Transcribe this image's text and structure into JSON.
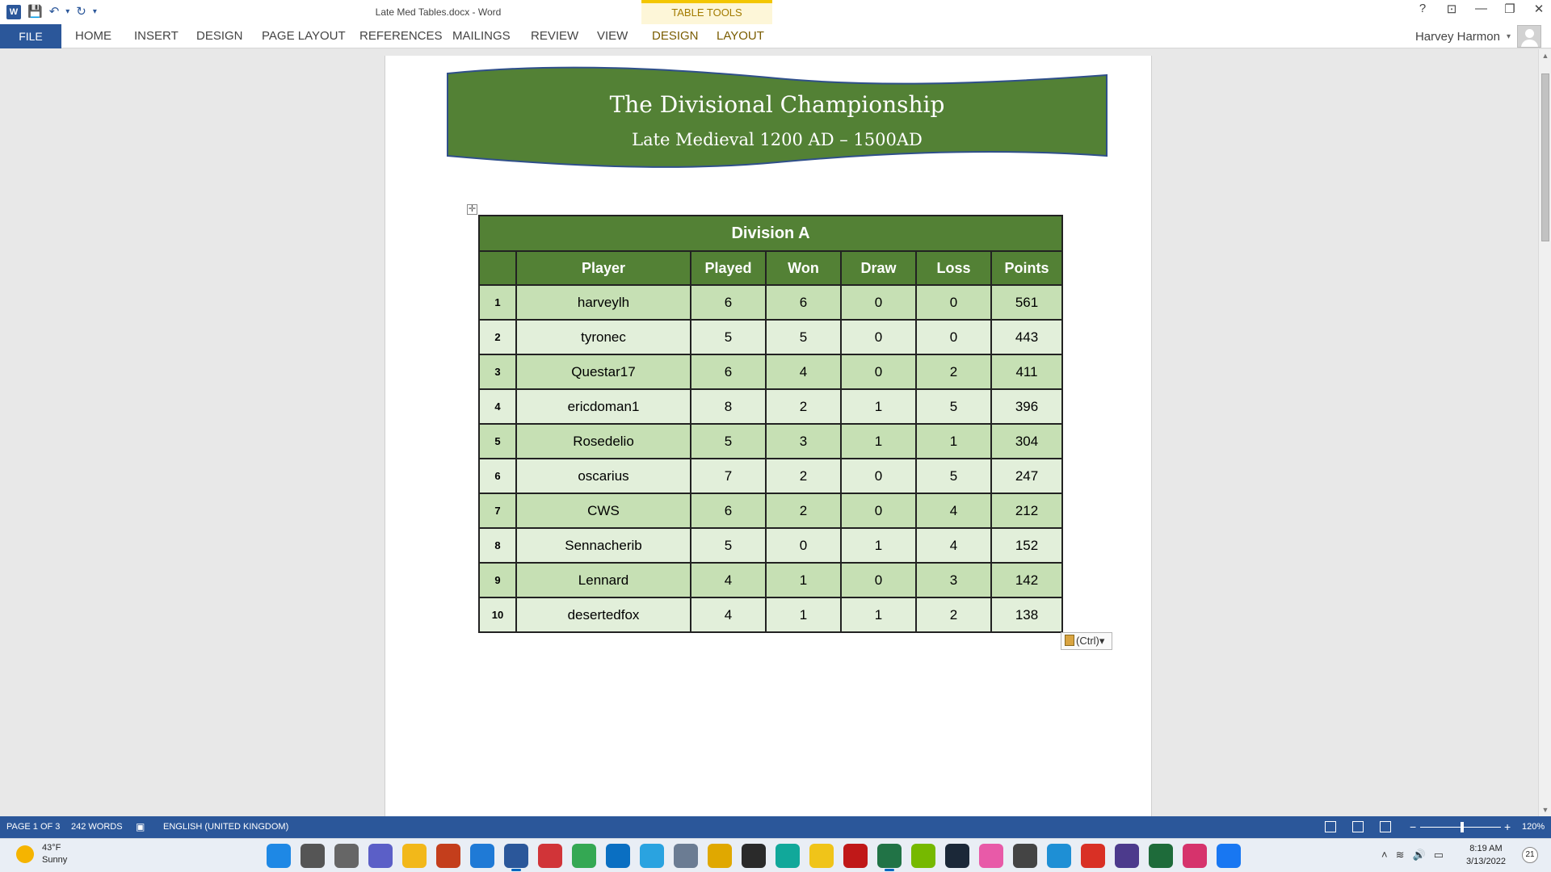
{
  "window": {
    "title": "Late Med Tables.docx - Word",
    "table_tools_label": "TABLE TOOLS",
    "controls": {
      "help": "?",
      "ribbon_display": "⊡",
      "minimize": "—",
      "restore": "❐",
      "close": "✕"
    }
  },
  "qat": {
    "save": "💾",
    "undo": "↶",
    "undo_caret": "▾",
    "redo": "↻",
    "customize": "▾"
  },
  "ribbon": {
    "file": "FILE",
    "tabs": [
      "HOME",
      "INSERT",
      "DESIGN",
      "PAGE LAYOUT",
      "REFERENCES",
      "MAILINGS",
      "REVIEW",
      "VIEW"
    ],
    "table_tabs": [
      "DESIGN",
      "LAYOUT"
    ],
    "user": "Harvey Harmon",
    "user_caret": "▾"
  },
  "document": {
    "banner_title": "The Divisional Championship",
    "banner_subtitle": "Late Medieval 1200 AD – 1500AD",
    "table": {
      "caption": "Division A",
      "headers": [
        "",
        "Player",
        "Played",
        "Won",
        "Draw",
        "Loss",
        "Points"
      ],
      "rows": [
        [
          "1",
          "harveylh",
          "6",
          "6",
          "0",
          "0",
          "561"
        ],
        [
          "2",
          "tyronec",
          "5",
          "5",
          "0",
          "0",
          "443"
        ],
        [
          "3",
          "Questar17",
          "6",
          "4",
          "0",
          "2",
          "411"
        ],
        [
          "4",
          "ericdoman1",
          "8",
          "2",
          "1",
          "5",
          "396"
        ],
        [
          "5",
          "Rosedelio",
          "5",
          "3",
          "1",
          "1",
          "304"
        ],
        [
          "6",
          "oscarius",
          "7",
          "2",
          "0",
          "5",
          "247"
        ],
        [
          "7",
          "CWS",
          "6",
          "2",
          "0",
          "4",
          "212"
        ],
        [
          "8",
          "Sennacherib",
          "5",
          "0",
          "1",
          "4",
          "152"
        ],
        [
          "9",
          "Lennard",
          "4",
          "1",
          "0",
          "3",
          "142"
        ],
        [
          "10",
          "desertedfox",
          "4",
          "1",
          "1",
          "2",
          "138"
        ]
      ]
    },
    "move_handle": "✛",
    "paste_options": "(Ctrl)▾"
  },
  "statusbar": {
    "page": "PAGE 1 OF 3",
    "words": "242 WORDS",
    "language": "ENGLISH (UNITED KINGDOM)",
    "zoom": "120%",
    "zoom_minus": "−",
    "zoom_plus": "+"
  },
  "taskbar": {
    "weather_temp": "43°F",
    "weather_desc": "Sunny",
    "time": "8:19 AM",
    "date": "3/13/2022",
    "notifications": "21",
    "apps": [
      {
        "name": "start",
        "color": "#1e88e5"
      },
      {
        "name": "search",
        "color": "#555555"
      },
      {
        "name": "task-view",
        "color": "#666666"
      },
      {
        "name": "teams",
        "color": "#5b5fc7"
      },
      {
        "name": "file-explorer",
        "color": "#f2b81a"
      },
      {
        "name": "powerpoint",
        "color": "#c43e1c"
      },
      {
        "name": "store",
        "color": "#1f7ad6"
      },
      {
        "name": "word",
        "color": "#2b579a"
      },
      {
        "name": "gift",
        "color": "#d13438"
      },
      {
        "name": "chrome",
        "color": "#34a853"
      },
      {
        "name": "photos",
        "color": "#0a6fc2"
      },
      {
        "name": "tips",
        "color": "#2aa3e0"
      },
      {
        "name": "settings",
        "color": "#6b7c93"
      },
      {
        "name": "files",
        "color": "#e0a800"
      },
      {
        "name": "epic-games",
        "color": "#2a2a2a"
      },
      {
        "name": "app-teal",
        "color": "#11a89a"
      },
      {
        "name": "app-yellow",
        "color": "#f0c419"
      },
      {
        "name": "mcafee",
        "color": "#c01818"
      },
      {
        "name": "excel",
        "color": "#217346"
      },
      {
        "name": "nvidia",
        "color": "#76b900"
      },
      {
        "name": "steam",
        "color": "#1b2838"
      },
      {
        "name": "itunes",
        "color": "#e85aa8"
      },
      {
        "name": "app-check",
        "color": "#444444"
      },
      {
        "name": "edge",
        "color": "#1e8fd5"
      },
      {
        "name": "gmail",
        "color": "#d93025"
      },
      {
        "name": "app-s",
        "color": "#4c3a8c"
      },
      {
        "name": "app-k",
        "color": "#1e6b3a"
      },
      {
        "name": "snip",
        "color": "#d6336c"
      },
      {
        "name": "facebook",
        "color": "#1877f2"
      }
    ]
  }
}
